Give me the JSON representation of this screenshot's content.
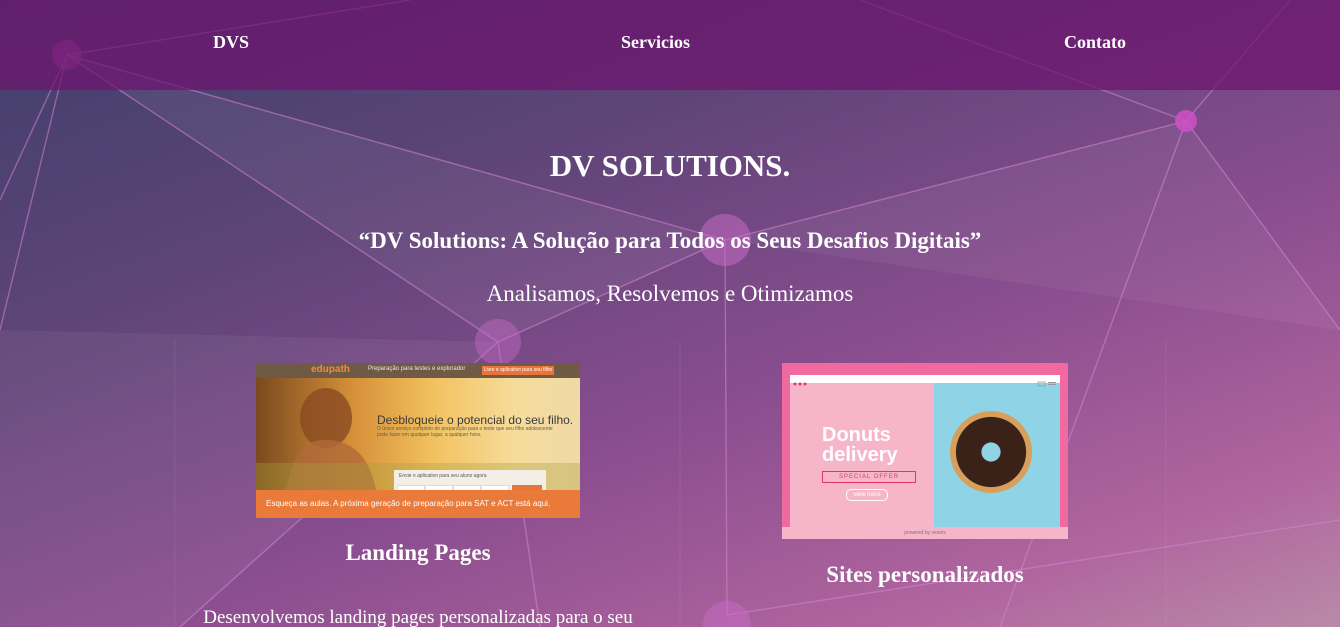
{
  "nav": {
    "brand": "DVS",
    "services": "Servicios",
    "contact": "Contato"
  },
  "hero": {
    "title": "DV SOLUTIONS.",
    "quote": "“DV Solutions: A Solução para Todos os Seus Desafios Digitais”",
    "tagline": "Analisamos, Resolvemos e Otimizamos"
  },
  "services": [
    {
      "title": "Landing Pages",
      "description": "Desenvolvemos landing pages personalizadas para o seu",
      "image": {
        "logo": "edupath",
        "topnav": "Preparação para testes e explorador",
        "cta": "Livre e aplicativo para seu filho",
        "headline": "Desbloqueie o potencial do seu filho.",
        "subtext": "O único serviço completo de preparação para o teste que seu filho adolescente pode fazer em qualquer lugar, a qualquer hora.",
        "form_label": "Envie o aplicativo para seu aluno agora",
        "footer": "Esqueça as aulas. A próxima geração de preparação para SAT e ACT está aqui."
      }
    },
    {
      "title": "Sites personalizados",
      "image": {
        "headline_line1": "Donuts",
        "headline_line2": "delivery",
        "offer": "SPECIAL OFFER",
        "button": "view more",
        "footer": "powered by vexels"
      }
    }
  ],
  "colors": {
    "nav_bg": "#6e146e",
    "node": "#c95fc0",
    "text": "#ffffff"
  }
}
